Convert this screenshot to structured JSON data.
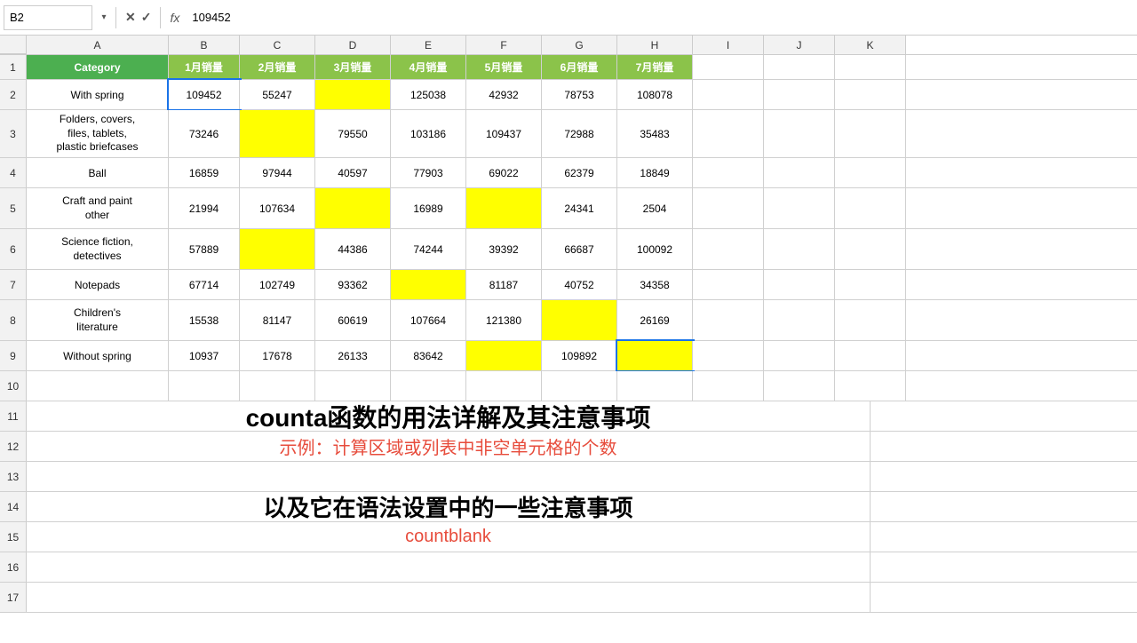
{
  "formulaBar": {
    "cellRef": "B2",
    "formula": "109452",
    "cancelLabel": "✕",
    "confirmLabel": "✓",
    "fxLabel": "fx"
  },
  "columns": {
    "headers": [
      "",
      "A",
      "B",
      "C",
      "D",
      "E",
      "F",
      "G",
      "H",
      "I",
      "J",
      "K"
    ],
    "labels": {
      "A": "Category",
      "B": "1月销量",
      "C": "2月销量",
      "D": "3月销量",
      "E": "4月销量",
      "F": "5月销量",
      "G": "6月销量",
      "H": "7月销量"
    }
  },
  "rows": [
    {
      "rowNum": "2",
      "category": "With spring",
      "B": "109452",
      "C": "55247",
      "D": "",
      "E": "125038",
      "F": "42932",
      "G": "78753",
      "H": "108078",
      "dYellow": true
    },
    {
      "rowNum": "3",
      "category": "Folders, covers,\nfiles, tablets,\nplastic briefcases",
      "B": "73246",
      "C": "",
      "D": "79550",
      "E": "103186",
      "F": "109437",
      "G": "72988",
      "H": "35483",
      "cYellow": true
    },
    {
      "rowNum": "4",
      "category": "Ball",
      "B": "16859",
      "C": "97944",
      "D": "40597",
      "E": "77903",
      "F": "69022",
      "G": "62379",
      "H": "18849"
    },
    {
      "rowNum": "5",
      "category": "Craft and paint\nother",
      "B": "21994",
      "C": "107634",
      "D": "",
      "E": "16989",
      "F": "",
      "G": "24341",
      "H": "2504",
      "dYellow": true,
      "fYellow": true
    },
    {
      "rowNum": "6",
      "category": "Science fiction,\ndetectives",
      "B": "57889",
      "C": "",
      "D": "44386",
      "E": "74244",
      "F": "39392",
      "G": "66687",
      "H": "100092",
      "cYellow": true
    },
    {
      "rowNum": "7",
      "category": "Notepads",
      "B": "67714",
      "C": "102749",
      "D": "93362",
      "E": "",
      "F": "81187",
      "G": "40752",
      "H": "34358",
      "eYellow": true
    },
    {
      "rowNum": "8",
      "category": "Children's\nliterature",
      "B": "15538",
      "C": "81147",
      "D": "60619",
      "E": "107664",
      "F": "121380",
      "G": "",
      "H": "26169",
      "gYellow": true
    },
    {
      "rowNum": "9",
      "category": "Without spring",
      "B": "10937",
      "C": "17678",
      "D": "26133",
      "E": "83642",
      "F": "",
      "G": "109892",
      "H": "",
      "fYellow": true,
      "hYellow": true,
      "hSelected": true
    }
  ],
  "textContent": {
    "title": "counta函数的用法详解及其注意事项",
    "subtitle": "示例：计算区域或列表中非空单元格的个数",
    "body": "以及它在语法设置中的一些注意事项",
    "code": "countblank"
  },
  "emptyRows": [
    "10",
    "11",
    "12",
    "13",
    "14",
    "15",
    "16",
    "17"
  ]
}
